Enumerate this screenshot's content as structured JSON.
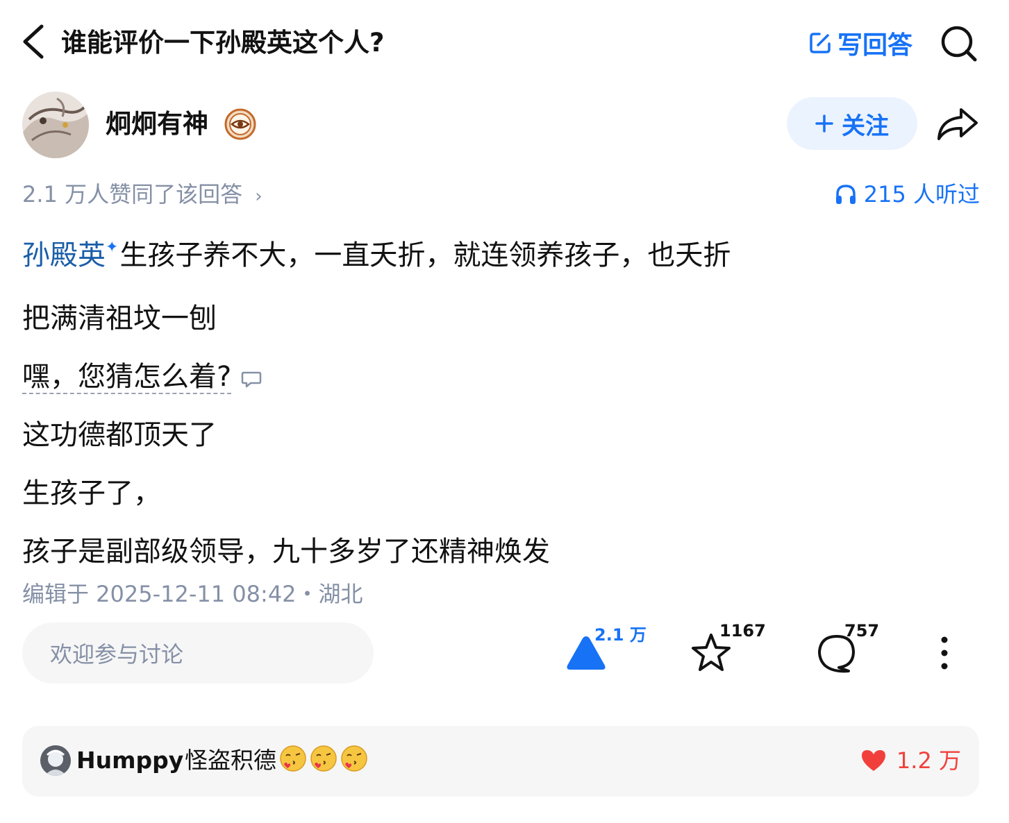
{
  "header": {
    "title": "谁能评价一下孙殿英这个人?",
    "write_answer_label": "写回答"
  },
  "author": {
    "name": "炯炯有神",
    "follow_label": "关注"
  },
  "meta": {
    "likes_text": "2.1 万人赞同了该回答",
    "listen_text": "215 人听过"
  },
  "content": {
    "mention": "孙殿英",
    "line1_rest": "生孩子养不大，一直夭折，就连领养孩子，也夭折",
    "line2": "把满清祖坟一刨",
    "line3": "嘿，您猜怎么着?",
    "line4": "这功德都顶天了",
    "line5": "生孩子了，",
    "line6": "孩子是副部级领导，九十多岁了还精神焕发"
  },
  "edit_info": "编辑于 2025-12-11 08:42・湖北",
  "actions": {
    "discuss_placeholder": "欢迎参与讨论",
    "vote_count": "2.1 万",
    "favorite_count": "1167",
    "comment_count": "757"
  },
  "top_comment": {
    "user": "Humppy",
    "text": "怪盗积德",
    "emoji_count": 3,
    "likes": "1.2 万"
  },
  "colors": {
    "accent": "#1772f6",
    "muted": "#8590a6",
    "like_red": "#f1403c"
  }
}
